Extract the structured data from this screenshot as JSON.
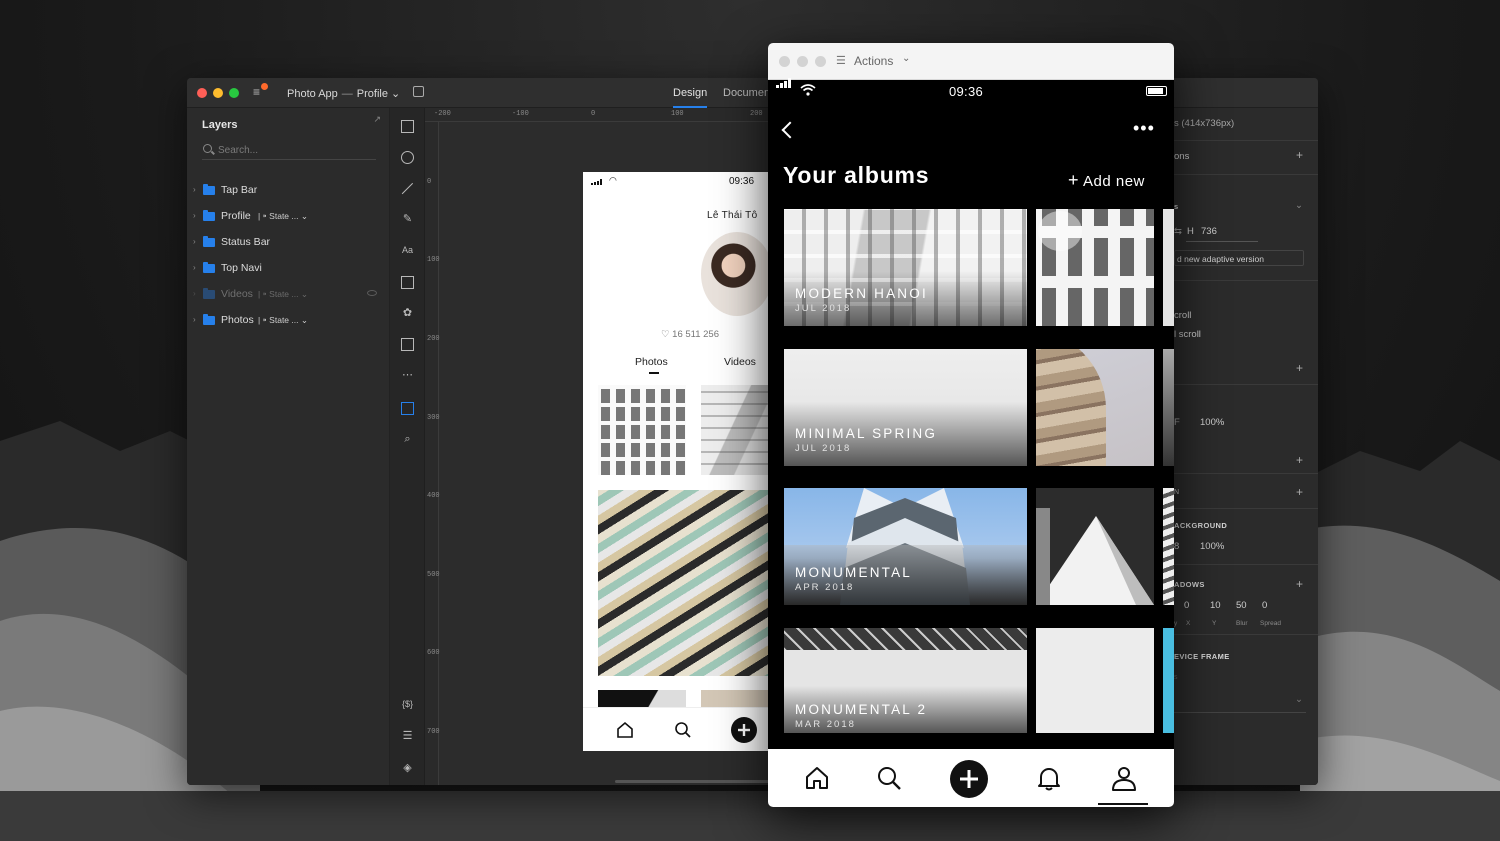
{
  "editor": {
    "doc_title": "Photo App",
    "doc_separator": "—",
    "doc_page": "Profile",
    "doc_page_chevron": "⌄",
    "tabs": {
      "design": "Design",
      "document": "Documen"
    }
  },
  "layers": {
    "title": "Layers",
    "search_placeholder": "Search...",
    "items": [
      {
        "label": "Tap Bar"
      },
      {
        "label": "Profile",
        "state": "| ⁍ State ... ⌄"
      },
      {
        "label": "Status Bar"
      },
      {
        "label": "Top Navi"
      },
      {
        "label": "Videos",
        "state": "| ⁍ State ... ⌄"
      },
      {
        "label": "Photos",
        "state": "| ⁍ State ... ⌄"
      }
    ]
  },
  "rulers": {
    "top": [
      "-200",
      "-100",
      "0",
      "100",
      "200"
    ],
    "left": [
      "0",
      "100",
      "200",
      "300",
      "400",
      "500",
      "600",
      "700"
    ]
  },
  "artboard": {
    "time": "09:36",
    "name": "Lê Thái Tô",
    "likes": "♡ 16 511 256",
    "tab_photos": "Photos",
    "tab_videos": "Videos"
  },
  "inspector": {
    "size": "s (414x736px)",
    "ons": "ons",
    "s": "s",
    "h_label": "H",
    "h_value": "736",
    "adaptive": "d new adaptive version",
    "scroll1": "croll",
    "scroll2": "l scroll",
    "f": "F",
    "opacity1": "100%",
    "n": "N",
    "background": "ACKGROUND",
    "bg_hex": "8",
    "opacity2": "100%",
    "shadows": "ADOWS",
    "shadow_values": [
      "0",
      "10",
      "50",
      "0"
    ],
    "shadow_labels": [
      "X",
      "Y",
      "Blur",
      "Spread"
    ],
    "shadow_y": "y",
    "device_frame": "EVICE FRAME",
    "device_frame_sub": "s"
  },
  "preview": {
    "actions_label": "Actions",
    "time": "09:36",
    "title": "Your albums",
    "add_new": "Add new",
    "more": "•••",
    "albums": [
      {
        "title": "MODERN HANOI",
        "date": "JUL 2018"
      },
      {
        "title": "MINIMAL SPRING",
        "date": "JUL 2018"
      },
      {
        "title": "MONUMENTAL",
        "date": "APR 2018"
      },
      {
        "title": "MONUMENTAL 2",
        "date": "MAR 2018"
      }
    ]
  }
}
